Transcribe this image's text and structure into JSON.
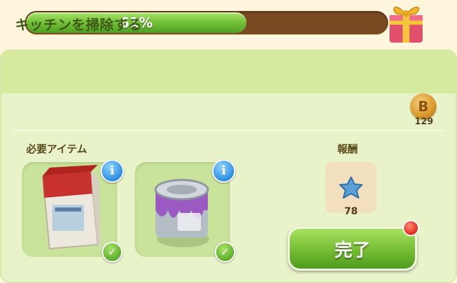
{
  "progress": {
    "percent": 61,
    "label": "61%"
  },
  "task": {
    "title": "キッチンを掃除する"
  },
  "coins": {
    "count": "129",
    "symbol": "B"
  },
  "required": {
    "label": "必要アイテム",
    "items": [
      {
        "name": "cleaning-powder-box",
        "info": "i"
      },
      {
        "name": "paint-can",
        "info": "i"
      }
    ]
  },
  "reward": {
    "label": "報酬",
    "count": "78",
    "icon": "blue-star-icon"
  },
  "complete_button": {
    "label": "完了"
  },
  "colors": {
    "accent_green": "#74bd32",
    "panel": "#e9f3c9",
    "header": "#d6eb9f"
  }
}
